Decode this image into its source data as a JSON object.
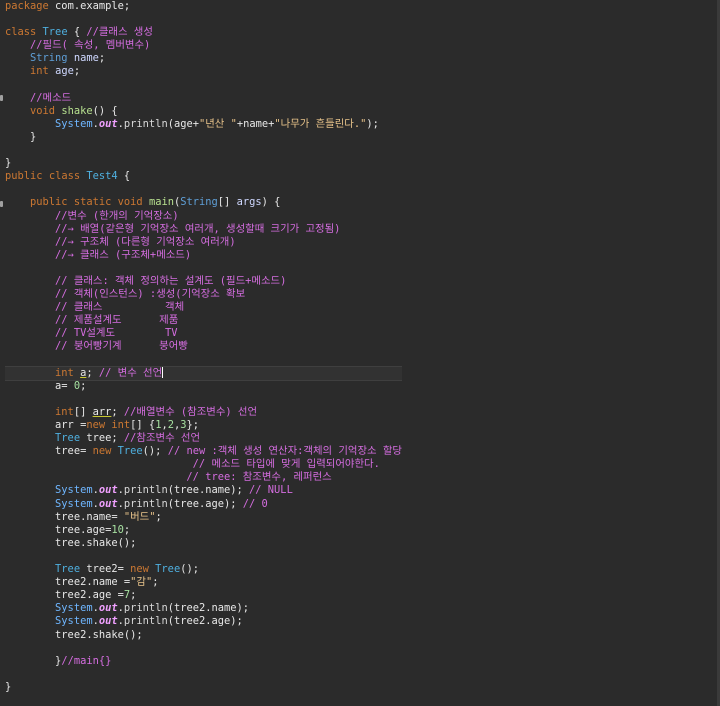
{
  "colors": {
    "background": "#2b2b2b",
    "keyword": "#cc7832",
    "type": "#5f9fd7",
    "comment": "#d56de0",
    "string": "#e8c38a",
    "number": "#a6e0a0",
    "text": "#e8e8e8"
  },
  "editor": {
    "current_line_index": 28,
    "lines": [
      [
        [
          "keyword",
          "package"
        ],
        [
          "plain",
          " com.example;"
        ]
      ],
      [],
      [
        [
          "keyword",
          "class"
        ],
        [
          "plain",
          " "
        ],
        [
          "classname",
          "Tree"
        ],
        [
          "plain",
          " { "
        ],
        [
          "comment",
          "//클래스 생성"
        ]
      ],
      [
        [
          "plain",
          "    "
        ],
        [
          "comment",
          "//필드( 속성, 멤버변수)"
        ]
      ],
      [
        [
          "plain",
          "    "
        ],
        [
          "type",
          "String"
        ],
        [
          "plain",
          " "
        ],
        [
          "field",
          "name"
        ],
        [
          "plain",
          ";"
        ]
      ],
      [
        [
          "plain",
          "    "
        ],
        [
          "keyword",
          "int"
        ],
        [
          "plain",
          " "
        ],
        [
          "field",
          "age"
        ],
        [
          "plain",
          ";"
        ]
      ],
      [],
      [
        [
          "plain",
          "    "
        ],
        [
          "comment",
          "//메소드"
        ]
      ],
      [
        [
          "plain",
          "    "
        ],
        [
          "keyword",
          "void"
        ],
        [
          "plain",
          " "
        ],
        [
          "deflike",
          "shake"
        ],
        [
          "plain",
          "() {"
        ]
      ],
      [
        [
          "plain",
          "        "
        ],
        [
          "system",
          "System"
        ],
        [
          "plain",
          "."
        ],
        [
          "out",
          "out"
        ],
        [
          "plain",
          "."
        ],
        [
          "method",
          "println"
        ],
        [
          "plain",
          "(age+"
        ],
        [
          "string",
          "\"년산 \""
        ],
        [
          "plain",
          "+name+"
        ],
        [
          "string",
          "\"나무가 흔들린다.\""
        ],
        [
          "plain",
          ");"
        ]
      ],
      [
        [
          "plain",
          "    }"
        ]
      ],
      [],
      [
        [
          "plain",
          "}"
        ]
      ],
      [
        [
          "keyword",
          "public"
        ],
        [
          "plain",
          " "
        ],
        [
          "keyword",
          "class"
        ],
        [
          "plain",
          " "
        ],
        [
          "classname",
          "Test4"
        ],
        [
          "plain",
          " {"
        ]
      ],
      [],
      [
        [
          "plain",
          "    "
        ],
        [
          "keyword",
          "public"
        ],
        [
          "plain",
          " "
        ],
        [
          "keyword",
          "static"
        ],
        [
          "plain",
          " "
        ],
        [
          "keyword",
          "void"
        ],
        [
          "plain",
          " "
        ],
        [
          "deflike",
          "main"
        ],
        [
          "plain",
          "("
        ],
        [
          "type",
          "String"
        ],
        [
          "plain",
          "[] "
        ],
        [
          "field",
          "args"
        ],
        [
          "plain",
          ") {"
        ]
      ],
      [
        [
          "plain",
          "        "
        ],
        [
          "comment",
          "//변수 (한개의 기억장소)"
        ]
      ],
      [
        [
          "plain",
          "        "
        ],
        [
          "comment",
          "//→ 배열(같은형 기억장소 여러개, 생성할때 크기가 고정됨)"
        ]
      ],
      [
        [
          "plain",
          "        "
        ],
        [
          "comment",
          "//→ 구조체 (다른형 기억장소 여러개)"
        ]
      ],
      [
        [
          "plain",
          "        "
        ],
        [
          "comment",
          "//→ 클래스 (구조체+메소드)"
        ]
      ],
      [],
      [
        [
          "plain",
          "        "
        ],
        [
          "comment",
          "// 클래스: 객체 정의하는 설계도 (필드+메소드)"
        ]
      ],
      [
        [
          "plain",
          "        "
        ],
        [
          "comment",
          "// 객체(인스턴스) :생성(기억장소 확보"
        ]
      ],
      [
        [
          "plain",
          "        "
        ],
        [
          "comment",
          "// 클래스          객체"
        ]
      ],
      [
        [
          "plain",
          "        "
        ],
        [
          "comment",
          "// 제품설계도      제품"
        ]
      ],
      [
        [
          "plain",
          "        "
        ],
        [
          "comment",
          "// TV설계도        TV"
        ]
      ],
      [
        [
          "plain",
          "        "
        ],
        [
          "comment",
          "// 붕어빵기계      붕어빵"
        ]
      ],
      [],
      [
        [
          "plain",
          "        "
        ],
        [
          "keyword",
          "int"
        ],
        [
          "plain",
          " "
        ],
        [
          "underline",
          "a"
        ],
        [
          "plain",
          "; "
        ],
        [
          "comment",
          "// 변수 선언"
        ],
        [
          "caret",
          ""
        ]
      ],
      [
        [
          "plain",
          "        a= "
        ],
        [
          "number",
          "0"
        ],
        [
          "plain",
          ";"
        ]
      ],
      [],
      [
        [
          "plain",
          "        "
        ],
        [
          "keyword",
          "int"
        ],
        [
          "plain",
          "[] "
        ],
        [
          "underline",
          "arr"
        ],
        [
          "plain",
          "; "
        ],
        [
          "comment",
          "//배열변수 (참조변수) 선언"
        ]
      ],
      [
        [
          "plain",
          "        arr ="
        ],
        [
          "keyword",
          "new"
        ],
        [
          "plain",
          " "
        ],
        [
          "keyword",
          "int"
        ],
        [
          "plain",
          "[] {"
        ],
        [
          "number",
          "1"
        ],
        [
          "plain",
          ","
        ],
        [
          "number",
          "2"
        ],
        [
          "plain",
          ","
        ],
        [
          "number",
          "3"
        ],
        [
          "plain",
          "};"
        ]
      ],
      [
        [
          "plain",
          "        "
        ],
        [
          "classname",
          "Tree"
        ],
        [
          "plain",
          " tree; "
        ],
        [
          "comment",
          "//참조변수 선언"
        ]
      ],
      [
        [
          "plain",
          "        tree= "
        ],
        [
          "keyword",
          "new"
        ],
        [
          "plain",
          " "
        ],
        [
          "classname",
          "Tree"
        ],
        [
          "plain",
          "(); "
        ],
        [
          "comment",
          "// new :객체 생성 연산자:객체의 기억장소 할당"
        ]
      ],
      [
        [
          "plain",
          "                              "
        ],
        [
          "comment",
          "// 메소드 타입에 맞게 입력되어야한다."
        ]
      ],
      [
        [
          "plain",
          "                             "
        ],
        [
          "comment",
          "// tree: 참조변수, 레퍼런스"
        ]
      ],
      [
        [
          "plain",
          "        "
        ],
        [
          "system",
          "System"
        ],
        [
          "plain",
          "."
        ],
        [
          "out",
          "out"
        ],
        [
          "plain",
          "."
        ],
        [
          "method",
          "println"
        ],
        [
          "plain",
          "(tree.name); "
        ],
        [
          "comment",
          "// NULL"
        ]
      ],
      [
        [
          "plain",
          "        "
        ],
        [
          "system",
          "System"
        ],
        [
          "plain",
          "."
        ],
        [
          "out",
          "out"
        ],
        [
          "plain",
          "."
        ],
        [
          "method",
          "println"
        ],
        [
          "plain",
          "(tree.age); "
        ],
        [
          "comment",
          "// 0"
        ]
      ],
      [
        [
          "plain",
          "        tree.name= "
        ],
        [
          "string",
          "\"버드\""
        ],
        [
          "plain",
          ";"
        ]
      ],
      [
        [
          "plain",
          "        tree.age="
        ],
        [
          "number",
          "10"
        ],
        [
          "plain",
          ";"
        ]
      ],
      [
        [
          "plain",
          "        tree.shake();"
        ]
      ],
      [],
      [
        [
          "plain",
          "        "
        ],
        [
          "classname",
          "Tree"
        ],
        [
          "plain",
          " tree2= "
        ],
        [
          "keyword",
          "new"
        ],
        [
          "plain",
          " "
        ],
        [
          "classname",
          "Tree"
        ],
        [
          "plain",
          "();"
        ]
      ],
      [
        [
          "plain",
          "        tree2.name ="
        ],
        [
          "string",
          "\"감\""
        ],
        [
          "plain",
          ";"
        ]
      ],
      [
        [
          "plain",
          "        tree2.age ="
        ],
        [
          "number",
          "7"
        ],
        [
          "plain",
          ";"
        ]
      ],
      [
        [
          "plain",
          "        "
        ],
        [
          "system",
          "System"
        ],
        [
          "plain",
          "."
        ],
        [
          "out",
          "out"
        ],
        [
          "plain",
          "."
        ],
        [
          "method",
          "println"
        ],
        [
          "plain",
          "(tree2.name);"
        ]
      ],
      [
        [
          "plain",
          "        "
        ],
        [
          "system",
          "System"
        ],
        [
          "plain",
          "."
        ],
        [
          "out",
          "out"
        ],
        [
          "plain",
          "."
        ],
        [
          "method",
          "println"
        ],
        [
          "plain",
          "(tree2.age);"
        ]
      ],
      [
        [
          "plain",
          "        tree2.shake();"
        ]
      ],
      [],
      [
        [
          "plain",
          "        }"
        ],
        [
          "comment",
          "//main{}"
        ]
      ],
      [],
      [
        [
          "plain",
          "}"
        ]
      ]
    ]
  }
}
